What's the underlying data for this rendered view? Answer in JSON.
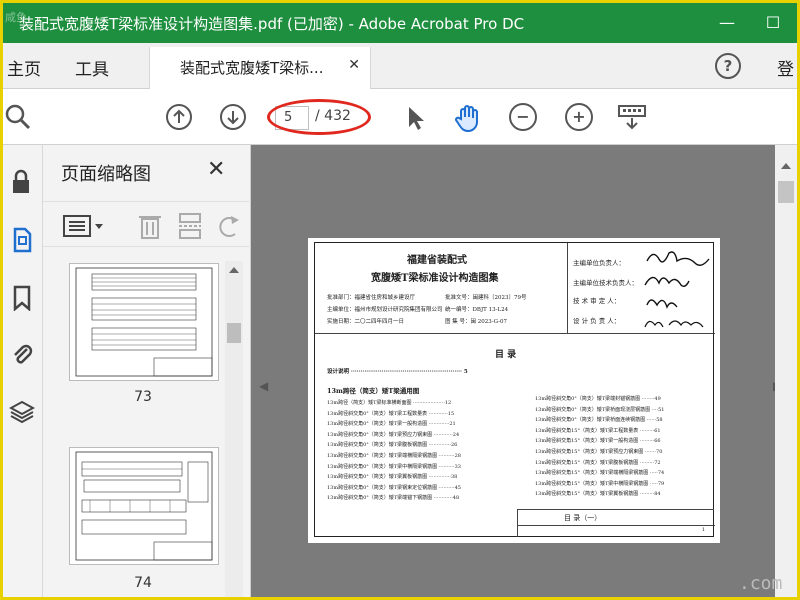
{
  "titlebar": {
    "watermark": "咸鱼",
    "title": "装配式宽腹矮T梁标准设计构造图集.pdf (已加密) - Adobe Acrobat Pro DC",
    "minimize": "—",
    "maximize": "☐"
  },
  "tabs": {
    "home": "主页",
    "tools": "工具",
    "document": "装配式宽腹矮T梁标...",
    "close": "✕",
    "help": "?",
    "login": "登"
  },
  "toolbar": {
    "page_current": "5",
    "page_total": "/ 432",
    "annotation_color": "#e0281e"
  },
  "thumbnails": {
    "title": "页面缩略图",
    "close": "✕",
    "pages": [
      "73",
      "74"
    ]
  },
  "document": {
    "header_line1": "福建省装配式",
    "header_line2": "宽腹矮T梁标准设计构造图集",
    "info_left": [
      "批准部门：福建省住房和城乡建设厅",
      "主编单位：福州市规划设计研究院集团有限公司",
      "实施日期：二〇二四年四月一日"
    ],
    "info_mid": [
      "批准文号：闽建科〔2023〕79号",
      "统一编号：DBJT 13-L24",
      "图 集 号：闽 2023-G-07"
    ],
    "roles": [
      "主编单位负责人：",
      "主编单位技术负责人：",
      "技 术 审 定 人：",
      "设 计 负 责 人："
    ],
    "toc_title": "目  录",
    "toc_design": "设计说明 ·························································· 5",
    "toc_section": "13m跨径（简支）矮T梁通用图",
    "toc_left": [
      "13m跨径（简支）矮T梁标准横断面图 ····················12",
      "13m跨径斜交角0°（简支）矮T梁工程数量表 ············15",
      "13m跨径斜交角0°（简支）矮T梁一般构造图 ·············21",
      "13m跨径斜交角0°（简支）矮T梁预应力钢束图 ············24",
      "13m跨径斜交角0°（简支）矮T梁腹板钢筋图 ··············26",
      "13m跨径斜交角0°（简支）矮T梁端横隔梁钢筋图 ··········28",
      "13m跨径斜交角0°（简支）矮T梁中横隔梁钢筋图 ··········33",
      "13m跨径斜交角0°（简支）矮T梁翼板钢筋图 ··············38",
      "13m跨径斜交角0°（简支）矮T梁钢束定位钢筋图 ··········45",
      "13m跨径斜交角0°（简支）矮T梁端锚下钢筋图 ············48"
    ],
    "toc_right": [
      "13m跨径斜交角0°（简支）矮T梁端封锚钢筋图 ········49",
      "13m跨径斜交角0°（简支）矮T梁桥面现浇层钢筋图 ····51",
      "13m跨径斜交角0°（简支）矮T梁桥面连续钢筋图 ······58",
      "13m跨径斜交角15°（简支）矮T梁工程数量表 ·········61",
      "13m跨径斜交角15°（简支）矮T梁一般构造图 ·········66",
      "13m跨径斜交角15°（简支）矮T梁预应力钢束图 ·······70",
      "13m跨径斜交角15°（简支）矮T梁腹板钢筋图 ·········72",
      "13m跨径斜交角15°（简支）矮T梁端横隔梁钢筋图 ·····74",
      "13m跨径斜交角15°（简支）矮T梁中横隔梁钢筋图 ·····79",
      "13m跨径斜交角15°（简支）矮T梁翼板钢筋图 ·········84"
    ],
    "footer_title": "目 录（一）",
    "footer_page": "1"
  },
  "corner_watermark": ".com"
}
